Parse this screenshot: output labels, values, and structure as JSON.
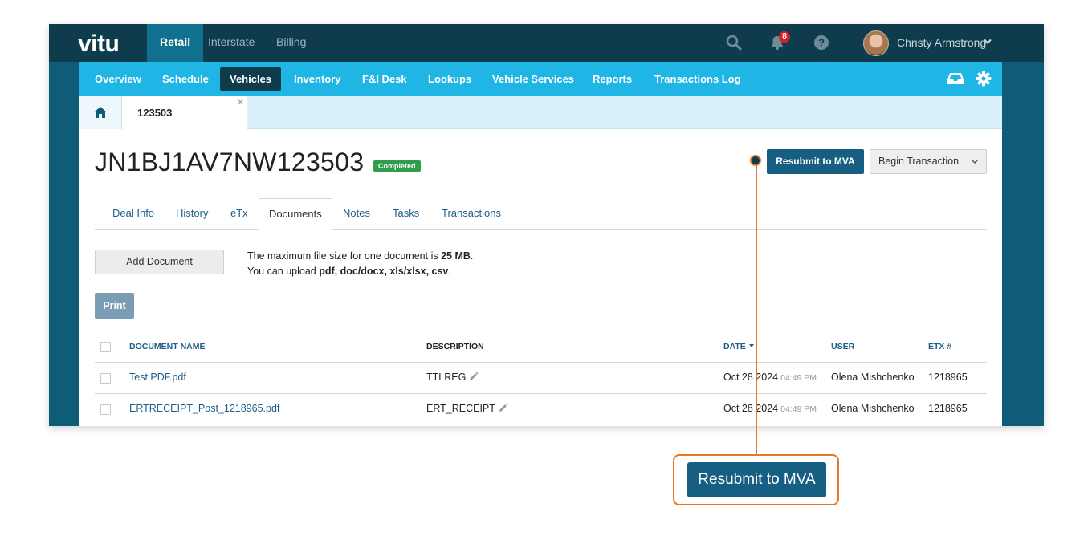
{
  "app": {
    "logo": "vitu",
    "top_tabs": [
      "Retail",
      "Interstate",
      "Billing"
    ],
    "active_top_tab": "Retail",
    "notification_count": "8",
    "user_name": "Christy Armstrong"
  },
  "nav": {
    "items": [
      "Overview",
      "Schedule",
      "Vehicles",
      "Inventory",
      "F&I Desk",
      "Lookups",
      "Vehicle Services",
      "Reports",
      "Transactions Log"
    ],
    "active": "Vehicles"
  },
  "tabstrip": {
    "open_tab": "123503"
  },
  "vehicle": {
    "vin": "JN1BJ1AV7NW123503",
    "status": "Completed"
  },
  "actions": {
    "resubmit_label": "Resubmit to MVA",
    "begin_label": "Begin Transaction"
  },
  "subtabs": {
    "items": [
      "Deal Info",
      "History",
      "eTx",
      "Documents",
      "Notes",
      "Tasks",
      "Transactions"
    ],
    "active": "Documents"
  },
  "documents": {
    "add_label": "Add Document",
    "info_line1_prefix": "The maximum file size for one document is ",
    "info_line1_bold": "25 MB",
    "info_line1_suffix": ".",
    "info_line2_prefix": "You can upload ",
    "info_line2_bold": "pdf, doc/docx, xls/xlsx, csv",
    "info_line2_suffix": ".",
    "print_label": "Print",
    "columns": {
      "name": "DOCUMENT NAME",
      "description": "DESCRIPTION",
      "date": "DATE",
      "user": "USER",
      "etx": "ETX #"
    },
    "rows": [
      {
        "name": "Test PDF.pdf",
        "description": "TTLREG",
        "date": "Oct 28 2024",
        "time": "04:49 PM",
        "user": "Olena Mishchenko",
        "etx": "1218965"
      },
      {
        "name": "ERTRECEIPT_Post_1218965.pdf",
        "description": "ERT_RECEIPT",
        "date": "Oct 28 2024",
        "time": "04:49 PM",
        "user": "Olena Mishchenko",
        "etx": "1218965"
      }
    ]
  },
  "callout": {
    "label": "Resubmit to MVA"
  },
  "colors": {
    "top_bar": "#0f3c4d",
    "nav_bar": "#1fb6e6",
    "primary_button": "#175e83",
    "callout_accent": "#e87722",
    "status_green": "#2e9e4a"
  }
}
